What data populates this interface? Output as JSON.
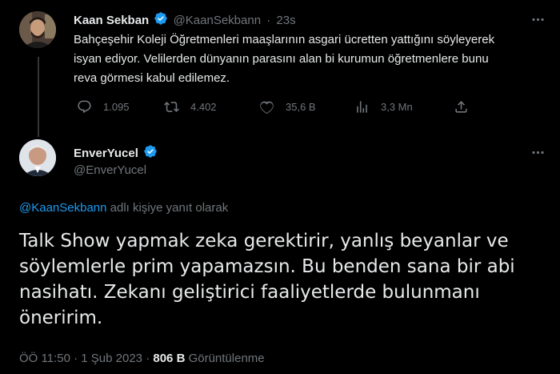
{
  "parent_tweet": {
    "display_name": "Kaan Sekban",
    "handle": "@KaanSekbann",
    "separator": "·",
    "time": "23s",
    "text": "Bahçeşehir Koleji Öğretmenleri maaşlarının asgari ücretten yattığını söyleyerek isyan ediyor. Velilerden dünyanın parasını alan bi kurumun öğretmenlere bunu reva görmesi kabul edilemez.",
    "stats": {
      "replies": "1.095",
      "retweets": "4.402",
      "likes": "35,6 B",
      "views": "3,3 Mn"
    },
    "icons": [
      "reply-icon",
      "retweet-icon",
      "like-icon",
      "views-icon",
      "share-icon",
      "more-icon",
      "verified-badge-icon"
    ]
  },
  "reply_tweet": {
    "display_name": "EnverYucel",
    "handle": "@EnverYucel",
    "replying_to_handle": "@KaanSekbann",
    "replying_to_suffix": "adlı kişiye yanıt olarak",
    "text": "Talk Show yapmak zeka gerektirir, yanlış beyanlar ve söylemlerle prim yapamazsın. Bu benden sana bir abi nasihatı. Zekanı geliştirici faaliyetlerde bulunmanı öneririm.",
    "time": "ÖÖ 11:50",
    "dot": "·",
    "date": "1 Şub 2023",
    "views_count": "806 B",
    "views_label": "Görüntülenme"
  },
  "colors": {
    "background": "#000000",
    "text": "#e7e9ea",
    "muted": "#71767b",
    "accent": "#1d9bf0",
    "thread_line": "#333639"
  }
}
